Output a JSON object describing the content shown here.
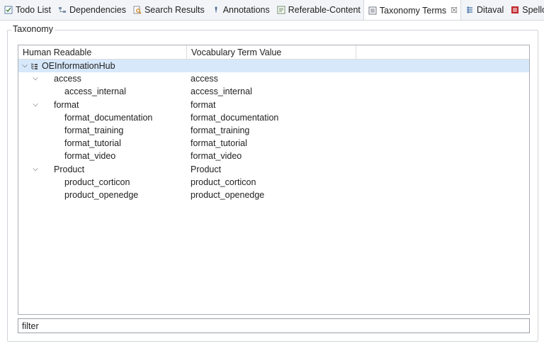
{
  "tabs": [
    {
      "label": "Todo List",
      "icon": "todo-list-icon"
    },
    {
      "label": "Dependencies",
      "icon": "dependencies-icon"
    },
    {
      "label": "Search Results",
      "icon": "search-results-icon"
    },
    {
      "label": "Annotations",
      "icon": "annotations-icon"
    },
    {
      "label": "Referable-Content",
      "icon": "referable-content-icon"
    },
    {
      "label": "Taxonomy Terms",
      "icon": "taxonomy-terms-icon",
      "active": true
    },
    {
      "label": "Ditaval",
      "icon": "ditaval-icon"
    },
    {
      "label": "Spellchecker",
      "icon": "spellchecker-icon"
    }
  ],
  "group": {
    "title": "Taxonomy"
  },
  "tree": {
    "columns": [
      "Human Readable",
      "Vocabulary Term Value"
    ],
    "rows": [
      {
        "label": "OEInformationHub",
        "value": "",
        "level": 0,
        "expanded": true,
        "selected": true,
        "icon": "taxonomy-root-icon"
      },
      {
        "label": "access",
        "value": "access",
        "level": 1,
        "expanded": true
      },
      {
        "label": "access_internal",
        "value": "access_internal",
        "level": 2
      },
      {
        "label": "format",
        "value": "format",
        "level": 1,
        "expanded": true
      },
      {
        "label": "format_documentation",
        "value": "format_documentation",
        "level": 2
      },
      {
        "label": "format_training",
        "value": "format_training",
        "level": 2
      },
      {
        "label": "format_tutorial",
        "value": "format_tutorial",
        "level": 2
      },
      {
        "label": "format_video",
        "value": "format_video",
        "level": 2
      },
      {
        "label": "Product",
        "value": "Product",
        "level": 1,
        "expanded": true
      },
      {
        "label": "product_corticon",
        "value": "product_corticon",
        "level": 2
      },
      {
        "label": "product_openedge",
        "value": "product_openedge",
        "level": 2
      }
    ]
  },
  "filter": {
    "value": "filter",
    "placeholder": "filter"
  },
  "colors": {
    "selection": "#d7e8fb",
    "tab_bar": "#f2f4f7",
    "border": "#a9aeb5"
  }
}
